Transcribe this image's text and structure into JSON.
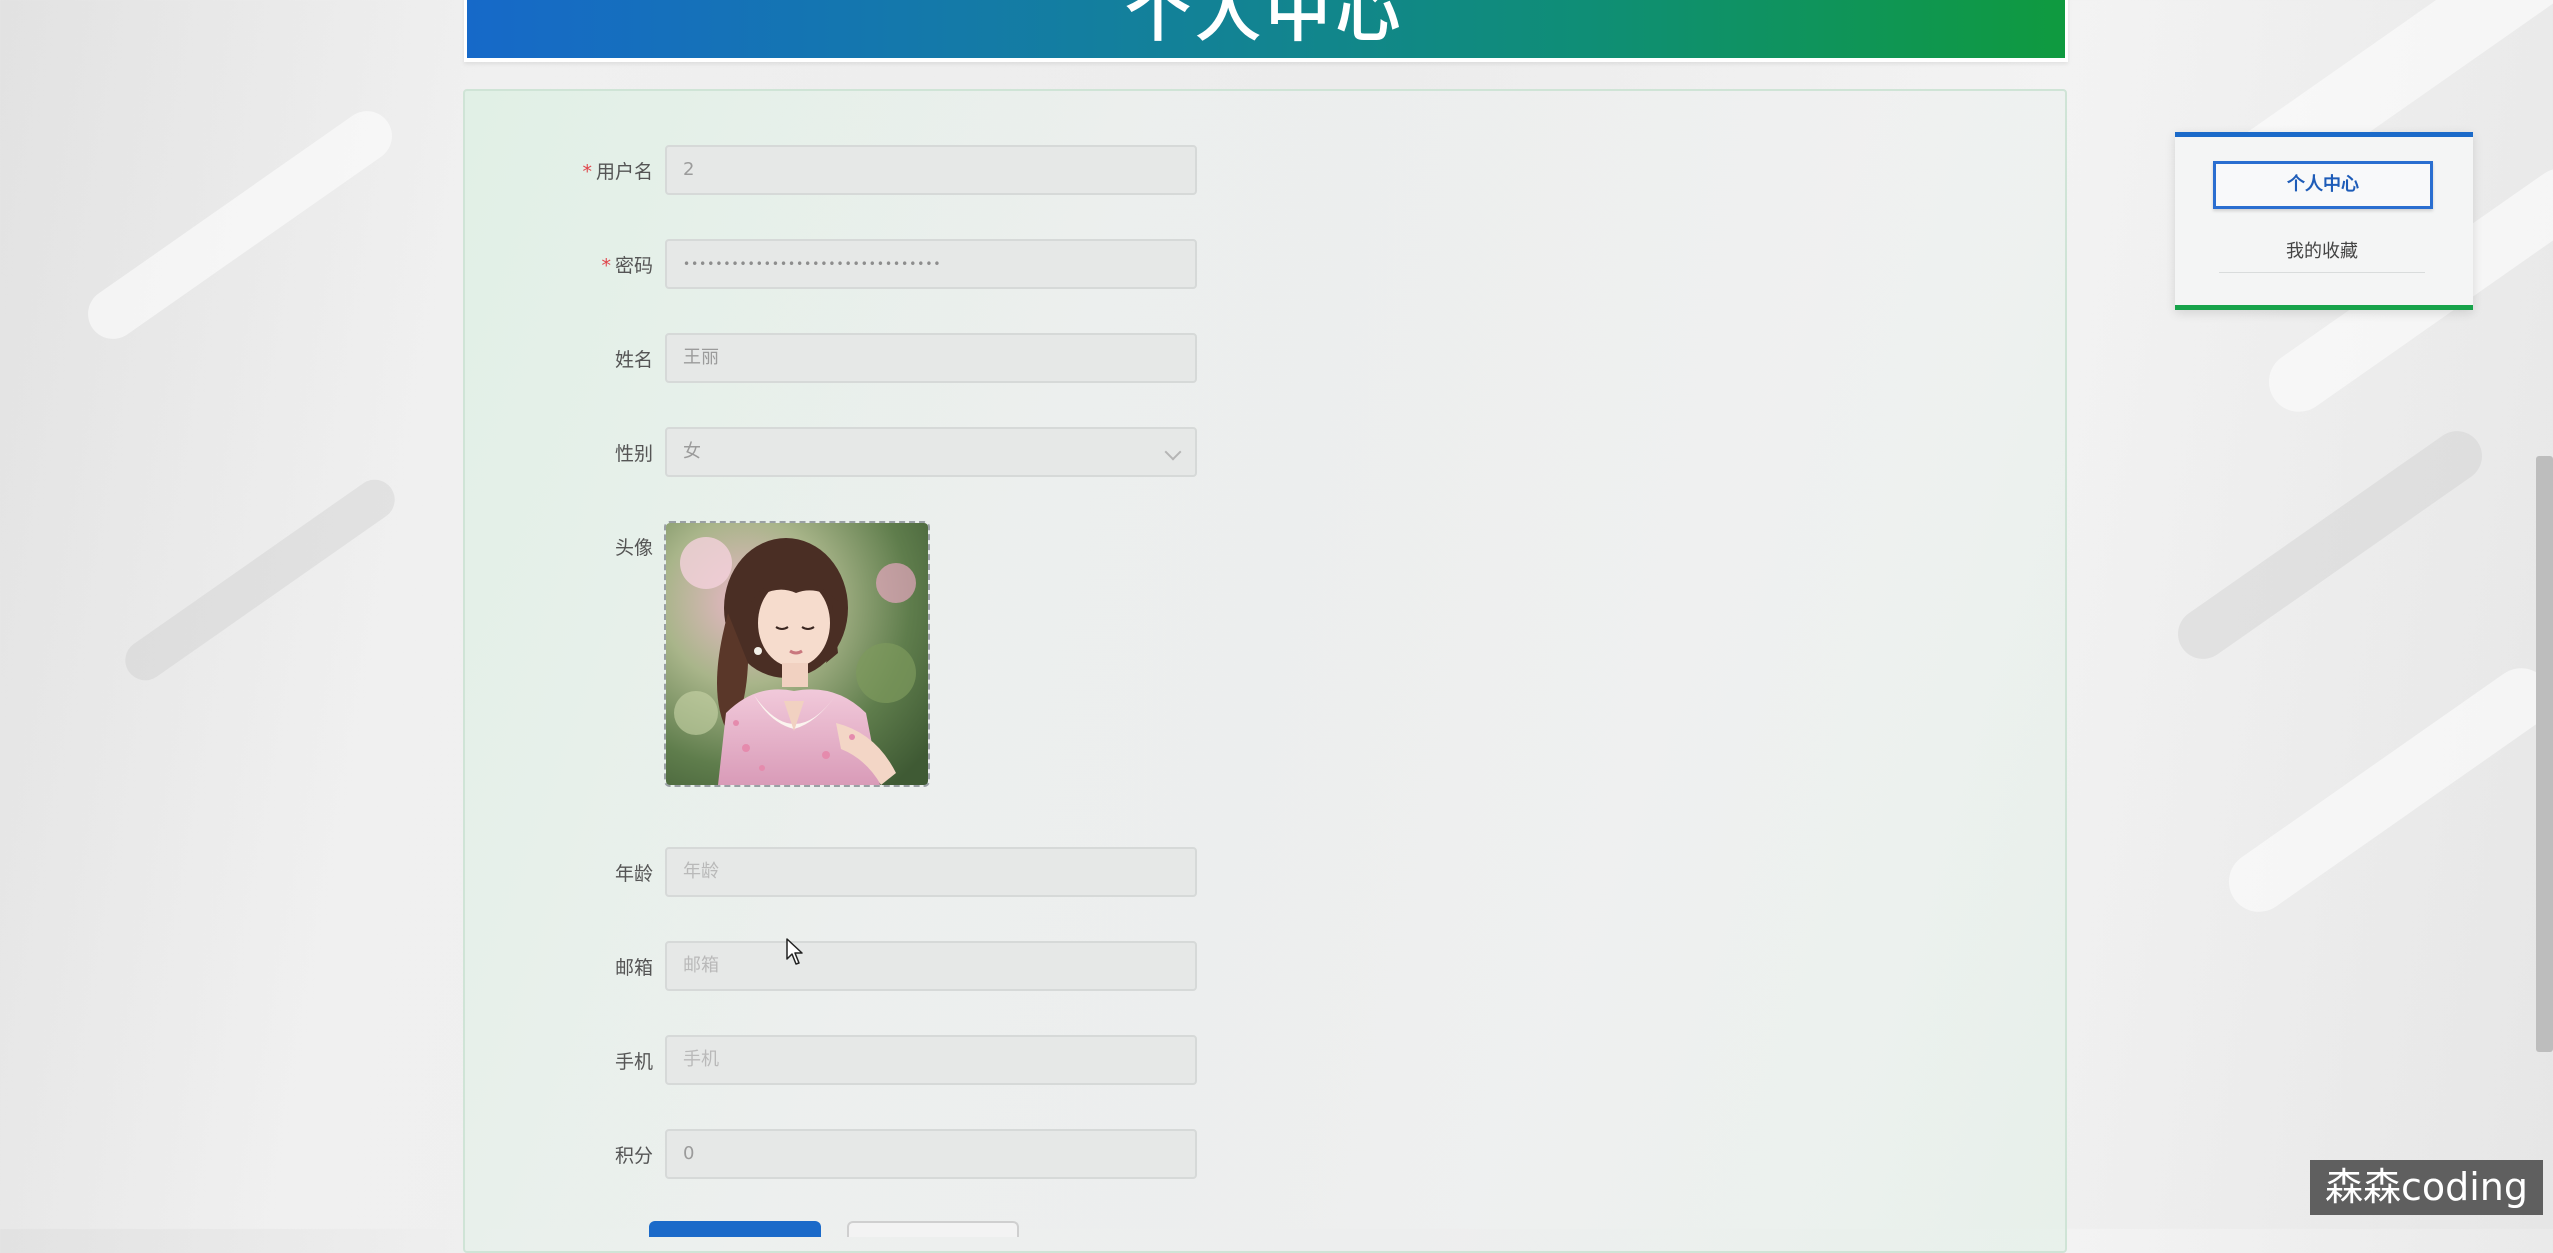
{
  "header": {
    "title": "个人中心"
  },
  "form": {
    "username": {
      "label": "用户名",
      "required": true,
      "value": "2"
    },
    "password": {
      "label": "密码",
      "required": true,
      "value": "••••••••••••••••••••••••••••••••"
    },
    "name": {
      "label": "姓名",
      "value": "王丽"
    },
    "gender": {
      "label": "性别",
      "value": "女"
    },
    "avatar": {
      "label": "头像"
    },
    "age": {
      "label": "年龄",
      "placeholder": "年龄"
    },
    "email": {
      "label": "邮箱",
      "placeholder": "邮箱"
    },
    "phone": {
      "label": "手机",
      "placeholder": "手机"
    },
    "points": {
      "label": "积分",
      "value": "0"
    }
  },
  "sidebar": {
    "items": [
      {
        "label": "个人中心",
        "active": true
      },
      {
        "label": "我的收藏",
        "active": false
      }
    ]
  },
  "watermark": {
    "text": "森森coding"
  },
  "colors": {
    "primary": "#1b6ac9",
    "accent_green": "#17a34a",
    "required": "#e0444a"
  }
}
